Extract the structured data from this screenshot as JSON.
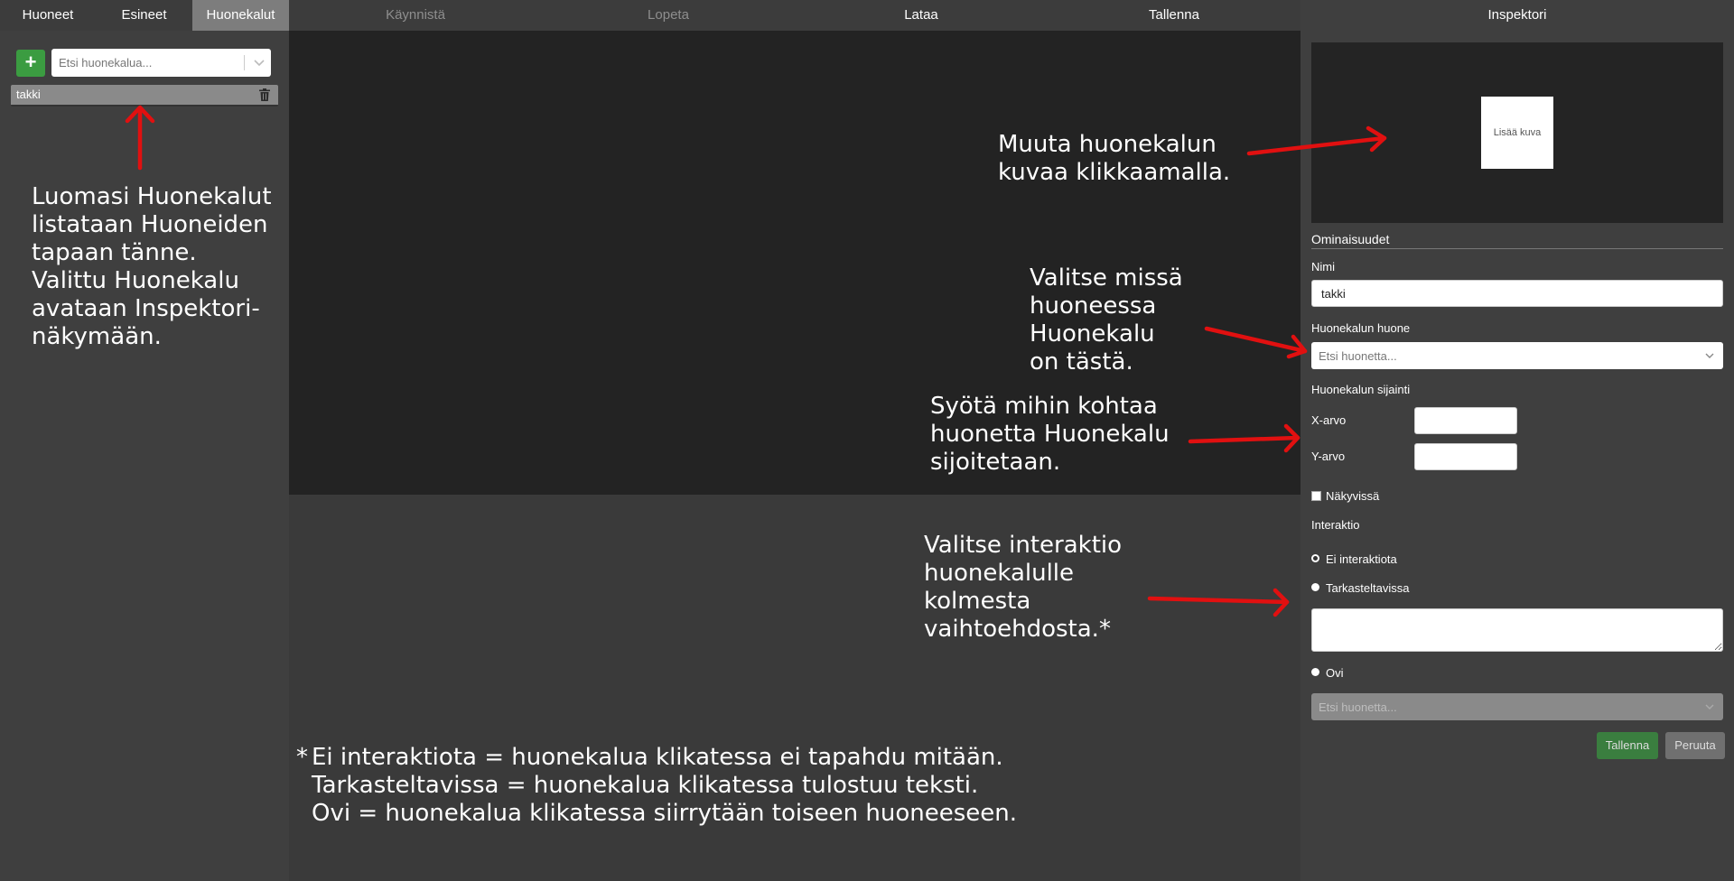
{
  "top_tabs": [
    {
      "label": "Huoneet",
      "active": false
    },
    {
      "label": "Esineet",
      "active": false
    },
    {
      "label": "Huonekalut",
      "active": true
    }
  ],
  "toolbar": {
    "start_label": "Käynnistä",
    "stop_label": "Lopeta",
    "load_label": "Lataa",
    "save_label": "Tallenna"
  },
  "sidebar": {
    "add_label": "+",
    "search_placeholder": "Etsi huonekalua...",
    "items": [
      {
        "label": "takki"
      }
    ]
  },
  "inspector": {
    "title": "Inspektori",
    "image_button": "Lisää kuva",
    "properties_title": "Ominaisuudet",
    "name_label": "Nimi",
    "name_value": "takki",
    "room_label": "Huonekalun huone",
    "room_placeholder": "Etsi huonetta...",
    "location_label": "Huonekalun sijainti",
    "x_label": "X-arvo",
    "y_label": "Y-arvo",
    "x_value": "",
    "y_value": "",
    "visible_label": "Näkyvissä",
    "interaction_label": "Interaktio",
    "options": [
      "Ei interaktiota",
      "Tarkasteltavissa",
      "Ovi"
    ],
    "selected_option": "Ei interaktiota",
    "inspect_text": "",
    "door_placeholder": "Etsi huonetta...",
    "save_button": "Tallenna",
    "cancel_button": "Peruuta"
  },
  "annotations": {
    "sidebar_note": "Luomasi Huonekalut\nlistataan Huoneiden\ntapaan tänne.\nValittu Huonekalu\navataan Inspektori-\nnäkymään.",
    "image_note": "Muuta huonekalun\nkuvaa klikkaamalla.",
    "room_note": "Valitse missä\nhuoneessa\nHuonekalu\non tästä.",
    "position_note": "Syötä mihin kohtaa\nhuonetta Huonekalu\nsijoitetaan.",
    "interaction_note": "Valitse interaktio\nhuonekalulle\nkolmesta\nvaihtoehdosta.*",
    "footnote_star": "*",
    "footnote": "Ei interaktiota = huonekalua klikatessa ei tapahdu mitään.\nTarkasteltavissa = huonekalua klikatessa tulostuu teksti.\nOvi = huonekalua klikatessa siirrytään toiseen huoneeseen."
  },
  "colors": {
    "add_button": "#3b9c41",
    "active_tab": "#7d7d7d",
    "annotation_arrow": "#e11010",
    "canvas_dark": "#232323"
  }
}
